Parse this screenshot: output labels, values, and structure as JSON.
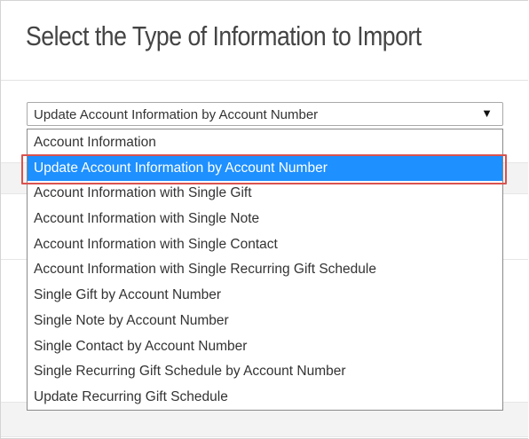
{
  "heading": "Select the Type of Information to Import",
  "select": {
    "selected_value": "Update Account Information by Account Number",
    "arrow_glyph": "▼"
  },
  "options": [
    {
      "label": "Account Information",
      "selected": false
    },
    {
      "label": "Update Account Information by Account Number",
      "selected": true
    },
    {
      "label": "Account Information with Single Gift",
      "selected": false
    },
    {
      "label": "Account Information with Single Note",
      "selected": false
    },
    {
      "label": "Account Information with Single Contact",
      "selected": false
    },
    {
      "label": "Account Information with Single Recurring Gift Schedule",
      "selected": false
    },
    {
      "label": "Single Gift by Account Number",
      "selected": false
    },
    {
      "label": "Single Note by Account Number",
      "selected": false
    },
    {
      "label": "Single Contact by Account Number",
      "selected": false
    },
    {
      "label": "Single Recurring Gift Schedule by Account Number",
      "selected": false
    },
    {
      "label": "Update Recurring Gift Schedule",
      "selected": false
    }
  ],
  "colors": {
    "selection_highlight": "#1e90ff",
    "callout_border": "#d9534f",
    "heading_text": "#444444"
  },
  "icons": {
    "dropdown_arrow": "caret-down-icon"
  }
}
